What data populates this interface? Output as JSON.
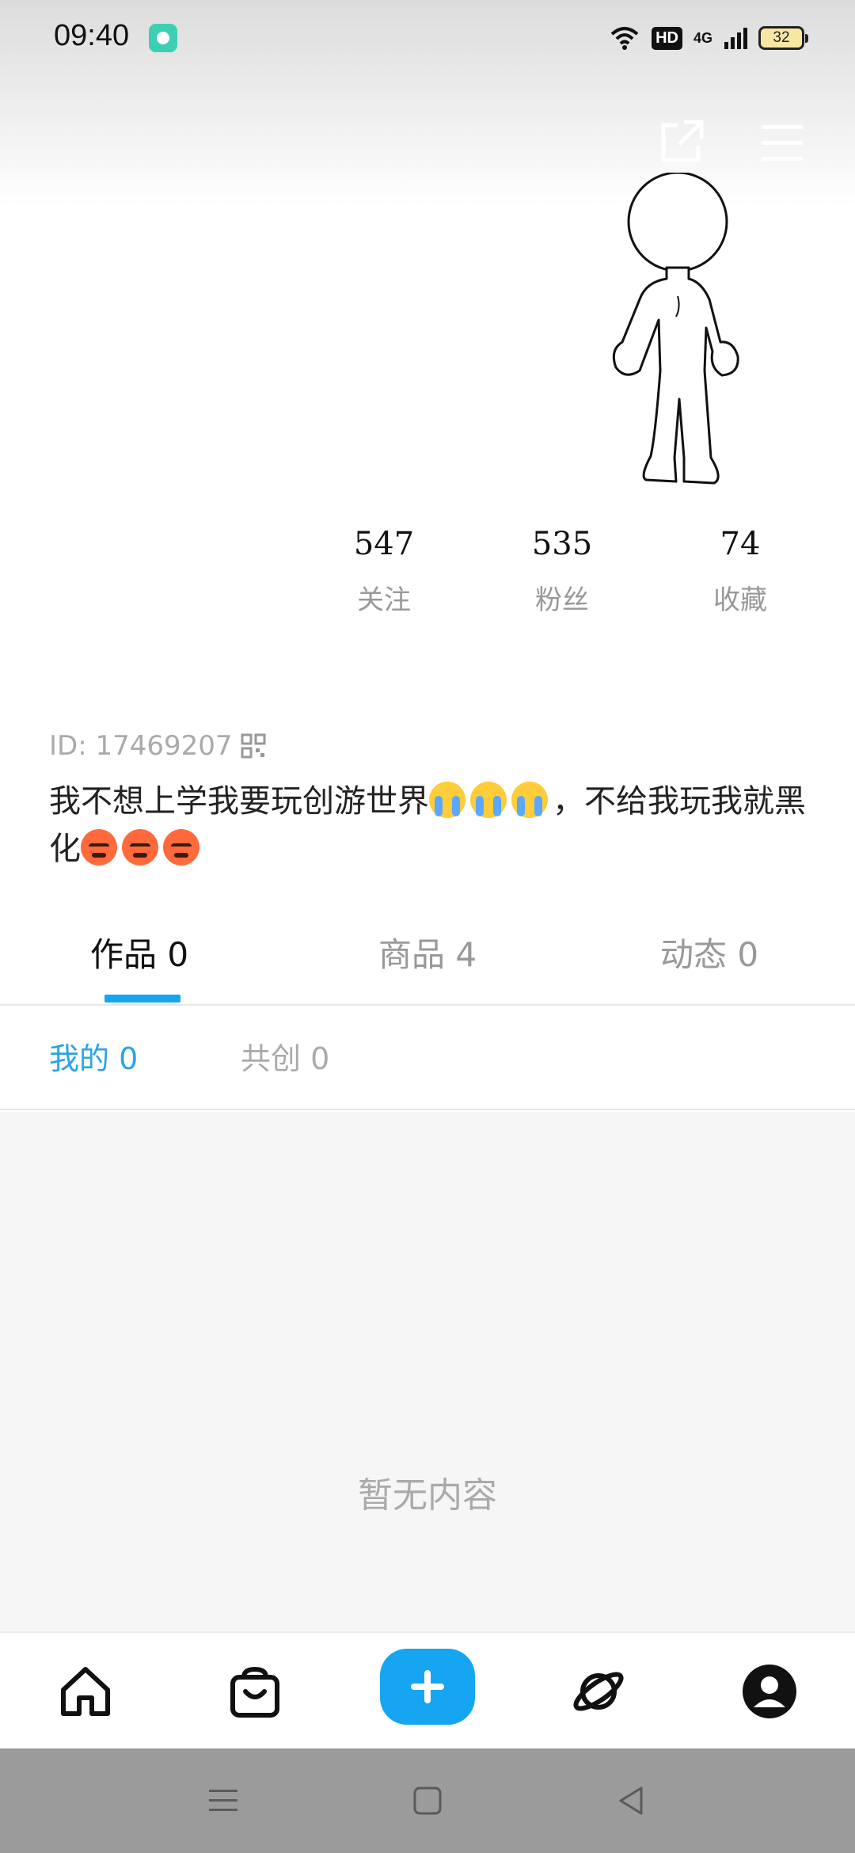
{
  "status_bar": {
    "time": "09:40",
    "app_icon": "music-app-icon",
    "hd_label": "HD",
    "network_label": "4G",
    "battery_level": "32"
  },
  "header": {
    "share_icon": "share-icon",
    "menu_icon": "menu-icon"
  },
  "profile": {
    "stats": [
      {
        "value": "547",
        "label": "关注"
      },
      {
        "value": "535",
        "label": "粉丝"
      },
      {
        "value": "74",
        "label": "收藏"
      }
    ],
    "id_text": "ID: 17469207",
    "bio_part1": "我不想上学我要玩创游世界",
    "bio_part2": "，不给我玩我就黑化"
  },
  "tabs": {
    "main": [
      {
        "label": "作品 0",
        "active": true
      },
      {
        "label": "商品 4",
        "active": false
      },
      {
        "label": "动态 0",
        "active": false
      }
    ],
    "sub": [
      {
        "label": "我的 0",
        "active": true
      },
      {
        "label": "共创 0",
        "active": false
      }
    ]
  },
  "content": {
    "empty_text": "暂无内容"
  },
  "bottom_nav": {
    "items": [
      "home-icon",
      "shop-bag-icon",
      "add-icon",
      "planet-icon",
      "profile-icon"
    ],
    "accent_color": "#16a6f1"
  }
}
